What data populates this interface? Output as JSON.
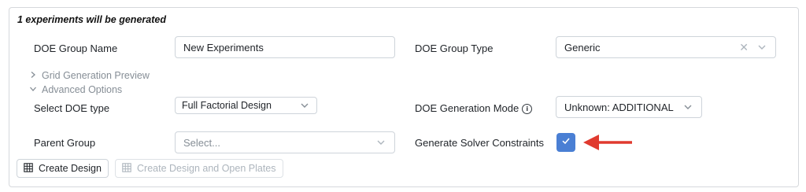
{
  "header": {
    "summary": "1 experiments will be generated"
  },
  "form": {
    "group_name": {
      "label": "DOE Group Name",
      "value": "New Experiments"
    },
    "group_type": {
      "label": "DOE Group Type",
      "value": "Generic"
    },
    "grid_preview": {
      "label": "Grid Generation Preview",
      "expanded": false
    },
    "advanced": {
      "label": "Advanced Options",
      "expanded": true
    },
    "doe_type": {
      "label": "Select DOE type",
      "value": "Full Factorial Design"
    },
    "generation_mode": {
      "label": "DOE Generation Mode",
      "value": "Unknown: ADDITIONAL",
      "info_icon": "info-icon"
    },
    "parent_group": {
      "label": "Parent Group",
      "placeholder": "Select..."
    },
    "solver_constraints": {
      "label": "Generate Solver Constraints",
      "checked": true
    }
  },
  "buttons": {
    "create_design": {
      "label": "Create Design",
      "icon": "grid-icon"
    },
    "create_open": {
      "label": "Create Design and Open Plates",
      "icon": "grid-icon",
      "disabled": true
    }
  },
  "colors": {
    "accent": "#4a7fd4",
    "annotation_arrow": "#e03a2f"
  }
}
